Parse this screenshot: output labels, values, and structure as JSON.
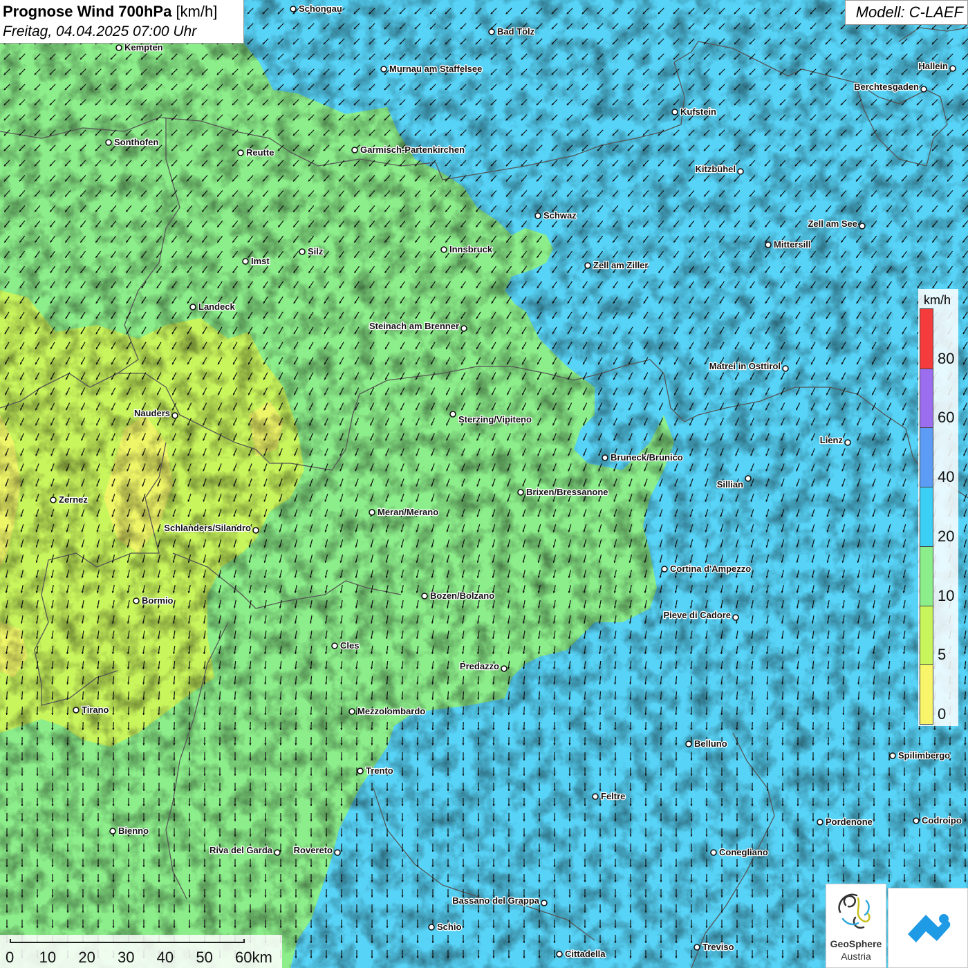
{
  "header": {
    "title_bold": "Prognose Wind 700hPa",
    "title_unit": "[km/h]",
    "subtitle": "Freitag, 04.04.2025 07:00 Uhr"
  },
  "model": {
    "label": "Modell: C-LAEF"
  },
  "legend": {
    "unit": "km/h",
    "classes": [
      {
        "from": 0,
        "to": 5,
        "color": "#f8f56a"
      },
      {
        "from": 5,
        "to": 10,
        "color": "#c9f55c"
      },
      {
        "from": 10,
        "to": 20,
        "color": "#8cee8a"
      },
      {
        "from": 20,
        "to": 40,
        "color": "#3ccff5"
      },
      {
        "from": 40,
        "to": 60,
        "color": "#5c9cf4"
      },
      {
        "from": 60,
        "to": 80,
        "color": "#9b6ef0"
      },
      {
        "from": 80,
        "to": 100,
        "color": "#f43c3c"
      }
    ],
    "tick_labels": [
      "0",
      "5",
      "10",
      "20",
      "40",
      "60",
      "80"
    ]
  },
  "scalebar": {
    "labels": [
      "0",
      "10",
      "20",
      "30",
      "40",
      "50",
      "60km"
    ]
  },
  "logos": {
    "geosphere_name": "GeoSphere",
    "geosphere_sub": "Austria",
    "logo_icon": "geosphere-swirl-icon",
    "app_icon": "cloud-arrow-icon"
  },
  "cities": [
    {
      "name": "Schongau",
      "label_side": "right"
    },
    {
      "name": "Bad Tölz",
      "label_side": "right"
    },
    {
      "name": "Kempten",
      "label_side": "right"
    },
    {
      "name": "Murnau am Staffelsee",
      "label_side": "right"
    },
    {
      "name": "Hallein",
      "label_side": "left"
    },
    {
      "name": "Berchtesgaden",
      "label_side": "left"
    },
    {
      "name": "Kufstein",
      "label_side": "right"
    },
    {
      "name": "Sonthofen",
      "label_side": "right"
    },
    {
      "name": "Reutte",
      "label_side": "right"
    },
    {
      "name": "Garmisch-Partenkirchen",
      "label_side": "right"
    },
    {
      "name": "Kitzbühel",
      "label_side": "left"
    },
    {
      "name": "Schwaz",
      "label_side": "right"
    },
    {
      "name": "Zell am See",
      "label_side": "left"
    },
    {
      "name": "Mittersill",
      "label_side": "right"
    },
    {
      "name": "Innsbruck",
      "label_side": "right"
    },
    {
      "name": "Silz",
      "label_side": "right"
    },
    {
      "name": "Imst",
      "label_side": "right"
    },
    {
      "name": "Zell am Ziller",
      "label_side": "right"
    },
    {
      "name": "Landeck",
      "label_side": "right"
    },
    {
      "name": "Steinach am Brenner",
      "label_side": "left"
    },
    {
      "name": "Matrei in Osttirol",
      "label_side": "left"
    },
    {
      "name": "Nauders",
      "label_side": "left"
    },
    {
      "name": "Sterzing/Vipiteno",
      "label_side": "right-below"
    },
    {
      "name": "Lienz",
      "label_side": "left"
    },
    {
      "name": "Bruneck/Brunico",
      "label_side": "right"
    },
    {
      "name": "Sillian",
      "label_side": "left-below"
    },
    {
      "name": "Brixen/Bressanone",
      "label_side": "right"
    },
    {
      "name": "Zernez",
      "label_side": "right"
    },
    {
      "name": "Meran/Merano",
      "label_side": "right"
    },
    {
      "name": "Schlanders/Silandro",
      "label_side": "left"
    },
    {
      "name": "Cortina d'Ampezzo",
      "label_side": "right"
    },
    {
      "name": "Bozen/Bolzano",
      "label_side": "right"
    },
    {
      "name": "Bormio",
      "label_side": "right"
    },
    {
      "name": "Pieve di Cadore",
      "label_side": "left"
    },
    {
      "name": "Cles",
      "label_side": "right"
    },
    {
      "name": "Predazzo",
      "label_side": "left"
    },
    {
      "name": "Tirano",
      "label_side": "right"
    },
    {
      "name": "Mezzolombardo",
      "label_side": "right"
    },
    {
      "name": "Belluno",
      "label_side": "right"
    },
    {
      "name": "Spilimbergo",
      "label_side": "right"
    },
    {
      "name": "Trento",
      "label_side": "right"
    },
    {
      "name": "Feltre",
      "label_side": "right"
    },
    {
      "name": "Pordenone",
      "label_side": "right"
    },
    {
      "name": "Codroipo",
      "label_side": "right"
    },
    {
      "name": "Bienno",
      "label_side": "right"
    },
    {
      "name": "Riva del Garda",
      "label_side": "left"
    },
    {
      "name": "Rovereto",
      "label_side": "left"
    },
    {
      "name": "Conegliano",
      "label_side": "right"
    },
    {
      "name": "Bassano del Grappa",
      "label_side": "left"
    },
    {
      "name": "Schio",
      "label_side": "right"
    },
    {
      "name": "Treviso",
      "label_side": "right"
    },
    {
      "name": "Cittadella",
      "label_side": "right"
    }
  ]
}
